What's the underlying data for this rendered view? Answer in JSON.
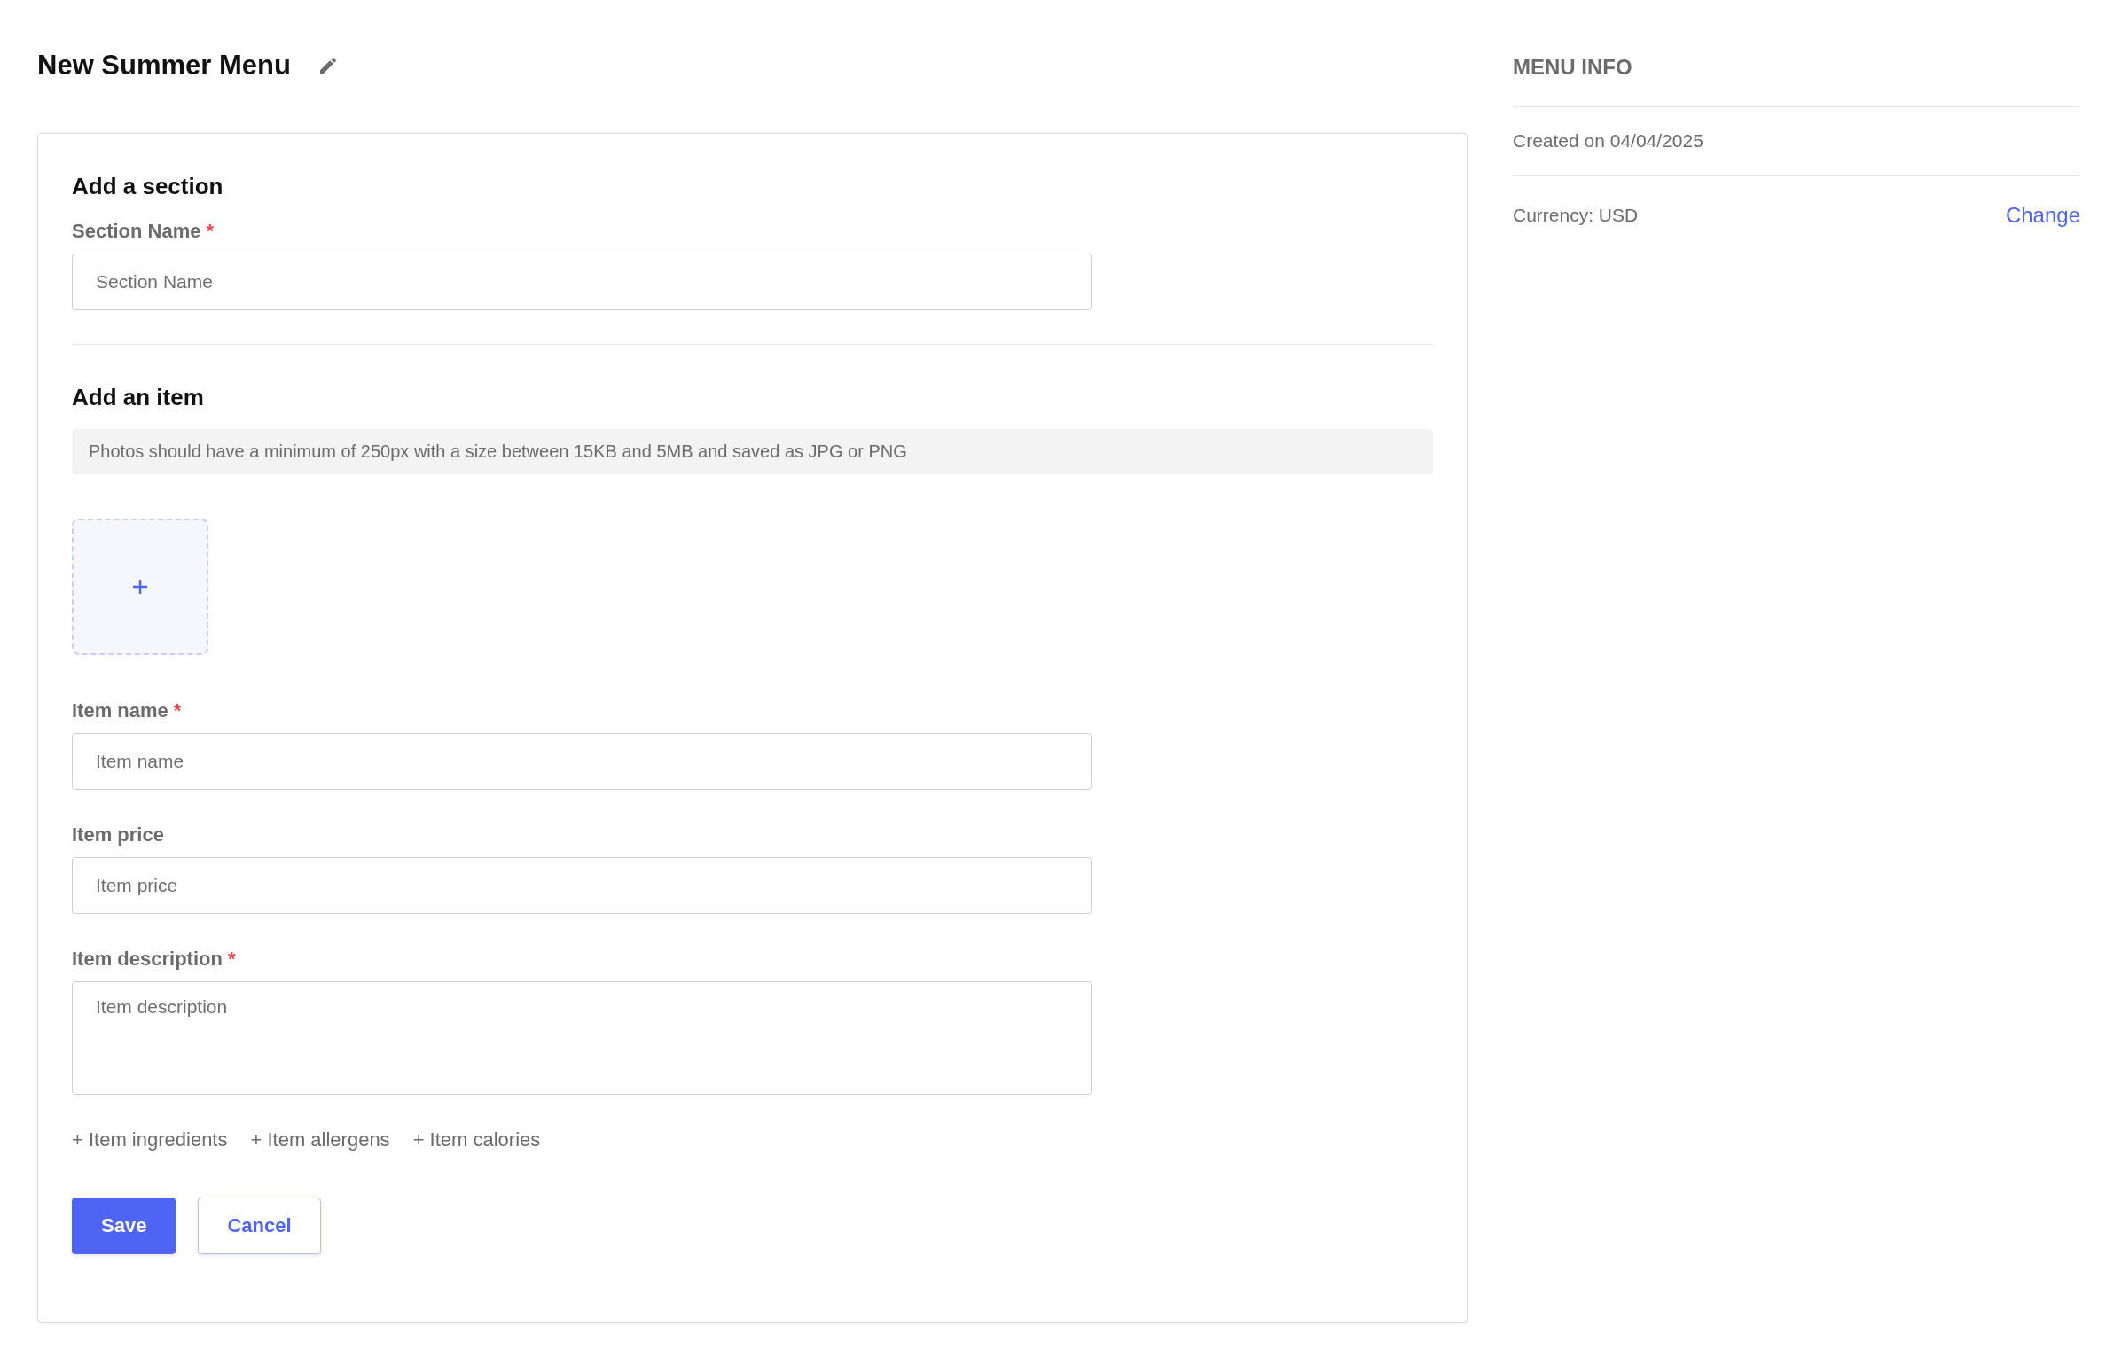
{
  "header": {
    "title": "New Summer Menu"
  },
  "section_form": {
    "heading": "Add a section",
    "fields": [
      {
        "label": "Section Name",
        "required_mark": "*",
        "placeholder": "Section Name",
        "kind": "input"
      }
    ]
  },
  "item_form": {
    "heading": "Add an item",
    "notice": "Photos should have a minimum of 250px with a size between 15KB and 5MB and saved as JPG or PNG",
    "fields": [
      {
        "label": "Item name",
        "required_mark": "*",
        "placeholder": "Item name",
        "kind": "input"
      },
      {
        "label": "Item price",
        "placeholder": "Item price",
        "kind": "input"
      },
      {
        "label": "Item description",
        "required_mark": "*",
        "placeholder": "Item description",
        "kind": "textarea"
      }
    ],
    "extras": [
      "+ Item ingredients",
      "+ Item allergens",
      "+ Item calories"
    ],
    "buttons": [
      {
        "label": "Save",
        "kind": "primary"
      },
      {
        "label": "Cancel",
        "kind": "secondary"
      }
    ]
  },
  "menu_info": {
    "heading": "MENU INFO",
    "created": "Created on 04/04/2025",
    "currency": "Currency: USD",
    "change_link": "Change"
  }
}
